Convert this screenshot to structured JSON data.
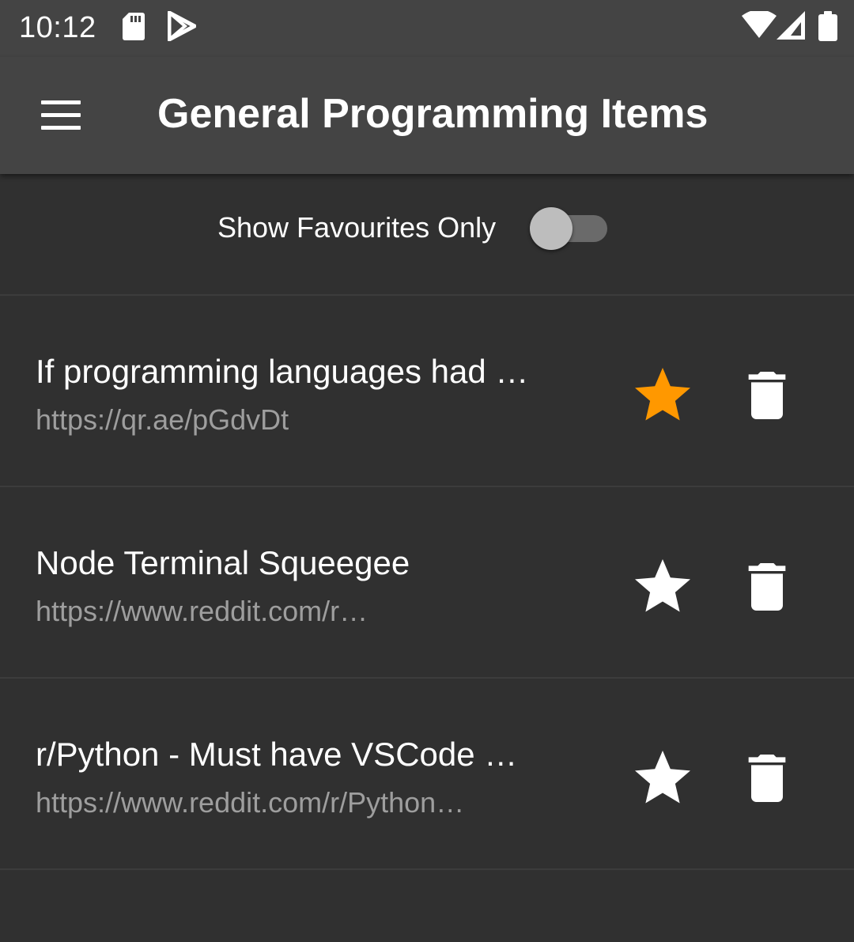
{
  "status_bar": {
    "time": "10:12",
    "left_icons": [
      "sd-card-icon",
      "play-store-icon"
    ],
    "right_icons": [
      "wifi-icon",
      "cellular-signal-icon",
      "battery-icon"
    ]
  },
  "app_bar": {
    "menu_icon": "menu-icon",
    "title": "General Programming Items"
  },
  "filter": {
    "label": "Show Favourites Only",
    "enabled": false
  },
  "items": [
    {
      "title": "If programming languages had …",
      "url": "https://qr.ae/pGdvDt",
      "favourite": true
    },
    {
      "title": "Node Terminal Squeegee",
      "url": "https://www.reddit.com/r…",
      "favourite": false
    },
    {
      "title": "r/Python - Must have VSCode …",
      "url": "https://www.reddit.com/r/Python…",
      "favourite": false
    }
  ],
  "colors": {
    "background": "#303030",
    "app_bar": "#444444",
    "favourite_star": "#FF9800",
    "star_default": "#FFFFFF",
    "url_text": "#9E9E9E"
  }
}
